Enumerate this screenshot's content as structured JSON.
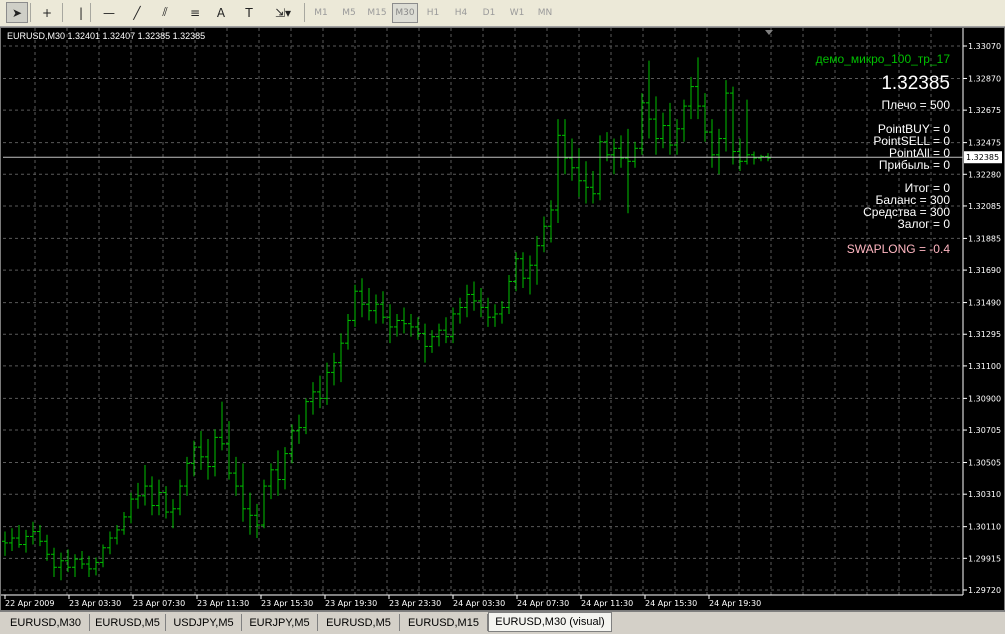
{
  "toolbar": {
    "tools": [
      {
        "name": "cursor-arrow-icon",
        "glyph": "➤",
        "active": true
      },
      {
        "name": "crosshair-icon",
        "glyph": "+",
        "active": false
      },
      {
        "name": "vertical-line-icon",
        "glyph": "|",
        "active": false
      },
      {
        "name": "horizontal-line-icon",
        "glyph": "—",
        "active": false
      },
      {
        "name": "trendline-icon",
        "glyph": "╱",
        "active": false
      },
      {
        "name": "equidistant-channel-icon",
        "glyph": "⫽",
        "active": false
      },
      {
        "name": "fibonacci-icon",
        "glyph": "≡",
        "active": false
      },
      {
        "name": "text-icon",
        "glyph": "A",
        "active": false
      },
      {
        "name": "text-label-icon",
        "glyph": "T",
        "active": false
      },
      {
        "name": "arrows-dropdown-icon",
        "glyph": "⇲▾",
        "active": false
      }
    ],
    "timeframes": [
      "M1",
      "M5",
      "M15",
      "M30",
      "H1",
      "H4",
      "D1",
      "W1",
      "MN"
    ],
    "active_timeframe": "M30"
  },
  "chart": {
    "header": "EURUSD,M30  1.32401 1.32407 1.32385 1.32385",
    "expert_name": "демо_микро_100_тр_17",
    "big_price": "1.32385",
    "leverage": "Плечо = 500",
    "info_lines": [
      "PointBUY = 0",
      "PointSELL = 0",
      "PointAll = 0",
      "Прибыль = 0"
    ],
    "account_lines": [
      "Итог = 0",
      "Баланс = 300",
      "Средства = 300",
      "Залог = 0"
    ],
    "swap_line": "SWAPLONG = -0.4",
    "current_price_label": "1.32385",
    "colors": {
      "background": "#000000",
      "grid": "#5a5a5a",
      "bars": "#00c000",
      "text": "#ffffff",
      "expert": "#00c000",
      "swap": "#ffb6c1",
      "price_line": "#c0c0c0"
    }
  },
  "chart_data": {
    "type": "bar",
    "title": "EURUSD,M30",
    "ylim": [
      1.2972,
      1.3307
    ],
    "y_ticks": [
      "1.33070",
      "1.32870",
      "1.32675",
      "1.32475",
      "1.32280",
      "1.32085",
      "1.31885",
      "1.31690",
      "1.31490",
      "1.31295",
      "1.31100",
      "1.30900",
      "1.30705",
      "1.30505",
      "1.30310",
      "1.30110",
      "1.29915",
      "1.29720"
    ],
    "x_ticks": [
      "22 Apr 2009",
      "23 Apr 03:30",
      "23 Apr 07:30",
      "23 Apr 11:30",
      "23 Apr 15:30",
      "23 Apr 19:30",
      "23 Apr 23:30",
      "24 Apr 03:30",
      "24 Apr 07:30",
      "24 Apr 11:30",
      "24 Apr 15:30",
      "24 Apr 19:30"
    ],
    "grid": true,
    "ohlc": [
      [
        1.3002,
        1.3008,
        1.2993,
        1.3001
      ],
      [
        1.3001,
        1.301,
        1.2996,
        1.3004
      ],
      [
        1.3004,
        1.3012,
        1.2998,
        1.3
      ],
      [
        1.3,
        1.3009,
        1.2995,
        1.3005
      ],
      [
        1.3005,
        1.3014,
        1.3,
        1.3008
      ],
      [
        1.3008,
        1.3012,
        1.2999,
        1.3002
      ],
      [
        1.3002,
        1.3006,
        1.299,
        1.2994
      ],
      [
        1.2994,
        1.2998,
        1.298,
        1.2986
      ],
      [
        1.2986,
        1.2995,
        1.2978,
        1.299
      ],
      [
        1.299,
        1.2997,
        1.2983,
        1.2986
      ],
      [
        1.2986,
        1.2994,
        1.298,
        1.2991
      ],
      [
        1.2991,
        1.2996,
        1.2985,
        1.2988
      ],
      [
        1.2988,
        1.2993,
        1.298,
        1.2985
      ],
      [
        1.2985,
        1.2992,
        1.2981,
        1.2989
      ],
      [
        1.2989,
        1.3,
        1.2986,
        1.2998
      ],
      [
        1.2998,
        1.3008,
        1.2994,
        1.3004
      ],
      [
        1.3004,
        1.3012,
        1.3,
        1.3009
      ],
      [
        1.3009,
        1.302,
        1.3006,
        1.3017
      ],
      [
        1.3017,
        1.3032,
        1.3013,
        1.3028
      ],
      [
        1.3028,
        1.3038,
        1.3022,
        1.303
      ],
      [
        1.303,
        1.3049,
        1.3024,
        1.3036
      ],
      [
        1.3036,
        1.3042,
        1.3018,
        1.3024
      ],
      [
        1.3024,
        1.304,
        1.3018,
        1.3032
      ],
      [
        1.3032,
        1.3036,
        1.3016,
        1.302
      ],
      [
        1.302,
        1.3028,
        1.301,
        1.3022
      ],
      [
        1.3022,
        1.304,
        1.3018,
        1.3036
      ],
      [
        1.3036,
        1.3054,
        1.303,
        1.305
      ],
      [
        1.305,
        1.3064,
        1.3042,
        1.306
      ],
      [
        1.306,
        1.307,
        1.3046,
        1.3054
      ],
      [
        1.3054,
        1.3065,
        1.304,
        1.3048
      ],
      [
        1.3048,
        1.3071,
        1.3042,
        1.3066
      ],
      [
        1.3066,
        1.3088,
        1.3058,
        1.3062
      ],
      [
        1.3062,
        1.3076,
        1.304,
        1.3044
      ],
      [
        1.3044,
        1.3054,
        1.303,
        1.3036
      ],
      [
        1.3036,
        1.305,
        1.3014,
        1.3022
      ],
      [
        1.3022,
        1.3032,
        1.3006,
        1.3018
      ],
      [
        1.3018,
        1.3025,
        1.3004,
        1.3012
      ],
      [
        1.3012,
        1.304,
        1.301,
        1.3036
      ],
      [
        1.3036,
        1.305,
        1.3028,
        1.3046
      ],
      [
        1.3046,
        1.3058,
        1.303,
        1.304
      ],
      [
        1.304,
        1.306,
        1.3034,
        1.3056
      ],
      [
        1.3056,
        1.3074,
        1.305,
        1.307
      ],
      [
        1.307,
        1.308,
        1.3062,
        1.3072
      ],
      [
        1.3072,
        1.309,
        1.3068,
        1.3088
      ],
      [
        1.3088,
        1.31,
        1.308,
        1.3094
      ],
      [
        1.3094,
        1.3104,
        1.3084,
        1.309
      ],
      [
        1.309,
        1.3112,
        1.3086,
        1.3106
      ],
      [
        1.3106,
        1.3118,
        1.3098,
        1.3112
      ],
      [
        1.3112,
        1.313,
        1.31,
        1.3124
      ],
      [
        1.3124,
        1.3142,
        1.312,
        1.3138
      ],
      [
        1.3138,
        1.316,
        1.3134,
        1.3156
      ],
      [
        1.3156,
        1.3164,
        1.314,
        1.3148
      ],
      [
        1.3148,
        1.3158,
        1.3138,
        1.3144
      ],
      [
        1.3144,
        1.3154,
        1.3136,
        1.3148
      ],
      [
        1.3148,
        1.3156,
        1.3136,
        1.314
      ],
      [
        1.314,
        1.3148,
        1.3124,
        1.3134
      ],
      [
        1.3134,
        1.3142,
        1.3128,
        1.3138
      ],
      [
        1.3138,
        1.3146,
        1.313,
        1.3136
      ],
      [
        1.3136,
        1.3142,
        1.3128,
        1.3134
      ],
      [
        1.3134,
        1.314,
        1.3126,
        1.313
      ],
      [
        1.313,
        1.3136,
        1.3112,
        1.3122
      ],
      [
        1.3122,
        1.3132,
        1.3118,
        1.3128
      ],
      [
        1.3128,
        1.3136,
        1.3122,
        1.3132
      ],
      [
        1.3132,
        1.314,
        1.3124,
        1.3128
      ],
      [
        1.3128,
        1.3146,
        1.3124,
        1.3142
      ],
      [
        1.3142,
        1.3152,
        1.3136,
        1.3146
      ],
      [
        1.3146,
        1.316,
        1.314,
        1.3154
      ],
      [
        1.3154,
        1.3162,
        1.3144,
        1.315
      ],
      [
        1.315,
        1.3158,
        1.314,
        1.3146
      ],
      [
        1.3146,
        1.3152,
        1.3134,
        1.314
      ],
      [
        1.314,
        1.3148,
        1.3134,
        1.3142
      ],
      [
        1.3142,
        1.315,
        1.3136,
        1.3146
      ],
      [
        1.3146,
        1.3166,
        1.3142,
        1.3162
      ],
      [
        1.3162,
        1.318,
        1.3156,
        1.3176
      ],
      [
        1.3176,
        1.318,
        1.3158,
        1.3164
      ],
      [
        1.3164,
        1.3178,
        1.3154,
        1.3172
      ],
      [
        1.3172,
        1.319,
        1.316,
        1.3184
      ],
      [
        1.3184,
        1.3202,
        1.318,
        1.3196
      ],
      [
        1.3196,
        1.3212,
        1.3186,
        1.3206
      ],
      [
        1.3206,
        1.3262,
        1.3198,
        1.3252
      ],
      [
        1.3252,
        1.3262,
        1.3228,
        1.3238
      ],
      [
        1.3238,
        1.325,
        1.3224,
        1.3232
      ],
      [
        1.3232,
        1.3244,
        1.3214,
        1.3224
      ],
      [
        1.3224,
        1.3236,
        1.321,
        1.322
      ],
      [
        1.322,
        1.323,
        1.321,
        1.3216
      ],
      [
        1.3216,
        1.3252,
        1.3212,
        1.3248
      ],
      [
        1.3248,
        1.3254,
        1.3236,
        1.324
      ],
      [
        1.324,
        1.325,
        1.3228,
        1.3244
      ],
      [
        1.3244,
        1.3252,
        1.3232,
        1.3238
      ],
      [
        1.3238,
        1.3256,
        1.3204,
        1.3236
      ],
      [
        1.3236,
        1.3248,
        1.3232,
        1.3244
      ],
      [
        1.3244,
        1.3278,
        1.324,
        1.3272
      ],
      [
        1.3272,
        1.3298,
        1.325,
        1.3262
      ],
      [
        1.3262,
        1.3276,
        1.324,
        1.325
      ],
      [
        1.325,
        1.3266,
        1.3244,
        1.3258
      ],
      [
        1.3258,
        1.3272,
        1.324,
        1.3246
      ],
      [
        1.3246,
        1.3262,
        1.324,
        1.3256
      ],
      [
        1.3256,
        1.3274,
        1.3248,
        1.327
      ],
      [
        1.327,
        1.3288,
        1.3262,
        1.3282
      ],
      [
        1.3282,
        1.33,
        1.3262,
        1.327
      ],
      [
        1.327,
        1.3278,
        1.3248,
        1.3254
      ],
      [
        1.3254,
        1.3262,
        1.3232,
        1.324
      ],
      [
        1.324,
        1.3256,
        1.3228,
        1.325
      ],
      [
        1.325,
        1.3286,
        1.3242,
        1.3278
      ],
      [
        1.3278,
        1.3282,
        1.3234,
        1.3242
      ],
      [
        1.3242,
        1.325,
        1.323,
        1.3236
      ],
      [
        1.3236,
        1.3274,
        1.3234,
        1.324
      ],
      [
        1.324,
        1.3242,
        1.3234,
        1.3238
      ],
      [
        1.3238,
        1.324,
        1.3236,
        1.3239
      ],
      [
        1.3239,
        1.3241,
        1.3236,
        1.3238
      ]
    ]
  },
  "tabs": {
    "items": [
      "EURUSD,M30",
      "EURUSD,M5",
      "USDJPY,M5",
      "EURJPY,M5",
      "EURUSD,M5",
      "EURUSD,M15",
      "EURUSD,M30 (visual)"
    ],
    "active_index": 6
  }
}
